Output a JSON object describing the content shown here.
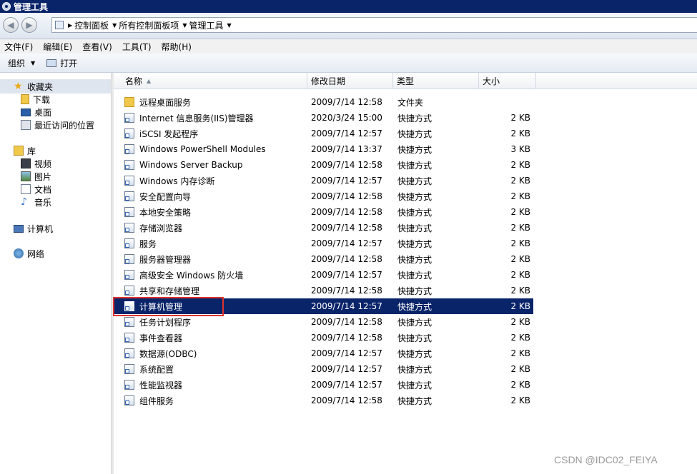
{
  "window": {
    "title": "管理工具"
  },
  "address": {
    "segments": [
      "控制面板",
      "所有控制面板项",
      "管理工具"
    ]
  },
  "menu": [
    "文件(F)",
    "编辑(E)",
    "查看(V)",
    "工具(T)",
    "帮助(H)"
  ],
  "toolbar": {
    "organize": "组织",
    "open": "打开"
  },
  "sidebar": {
    "favorites": {
      "label": "收藏夹",
      "items": [
        "下载",
        "桌面",
        "最近访问的位置"
      ]
    },
    "libraries": {
      "label": "库",
      "items": [
        "视频",
        "图片",
        "文档",
        "音乐"
      ]
    },
    "computer": "计算机",
    "network": "网络"
  },
  "columns": {
    "name": "名称",
    "date": "修改日期",
    "type": "类型",
    "size": "大小"
  },
  "rows": [
    {
      "name": "远程桌面服务",
      "date": "2009/7/14 12:58",
      "type": "文件夹",
      "size": "",
      "icon": "folder-icon"
    },
    {
      "name": "Internet 信息服务(IIS)管理器",
      "date": "2020/3/24 15:00",
      "type": "快捷方式",
      "size": "2 KB",
      "icon": "shortcut-icon"
    },
    {
      "name": "iSCSI 发起程序",
      "date": "2009/7/14 12:57",
      "type": "快捷方式",
      "size": "2 KB",
      "icon": "shortcut-icon"
    },
    {
      "name": "Windows PowerShell Modules",
      "date": "2009/7/14 13:37",
      "type": "快捷方式",
      "size": "3 KB",
      "icon": "shortcut-icon"
    },
    {
      "name": "Windows Server Backup",
      "date": "2009/7/14 12:58",
      "type": "快捷方式",
      "size": "2 KB",
      "icon": "shortcut-icon"
    },
    {
      "name": "Windows 内存诊断",
      "date": "2009/7/14 12:57",
      "type": "快捷方式",
      "size": "2 KB",
      "icon": "shortcut-icon"
    },
    {
      "name": "安全配置向导",
      "date": "2009/7/14 12:58",
      "type": "快捷方式",
      "size": "2 KB",
      "icon": "shortcut-icon"
    },
    {
      "name": "本地安全策略",
      "date": "2009/7/14 12:58",
      "type": "快捷方式",
      "size": "2 KB",
      "icon": "shortcut-icon"
    },
    {
      "name": "存储浏览器",
      "date": "2009/7/14 12:58",
      "type": "快捷方式",
      "size": "2 KB",
      "icon": "shortcut-icon"
    },
    {
      "name": "服务",
      "date": "2009/7/14 12:57",
      "type": "快捷方式",
      "size": "2 KB",
      "icon": "shortcut-icon"
    },
    {
      "name": "服务器管理器",
      "date": "2009/7/14 12:58",
      "type": "快捷方式",
      "size": "2 KB",
      "icon": "shortcut-icon"
    },
    {
      "name": "高级安全 Windows 防火墙",
      "date": "2009/7/14 12:57",
      "type": "快捷方式",
      "size": "2 KB",
      "icon": "shortcut-icon"
    },
    {
      "name": "共享和存储管理",
      "date": "2009/7/14 12:58",
      "type": "快捷方式",
      "size": "2 KB",
      "icon": "shortcut-icon"
    },
    {
      "name": "计算机管理",
      "date": "2009/7/14 12:57",
      "type": "快捷方式",
      "size": "2 KB",
      "icon": "shortcut-icon",
      "selected": true
    },
    {
      "name": "任务计划程序",
      "date": "2009/7/14 12:58",
      "type": "快捷方式",
      "size": "2 KB",
      "icon": "shortcut-icon"
    },
    {
      "name": "事件查看器",
      "date": "2009/7/14 12:58",
      "type": "快捷方式",
      "size": "2 KB",
      "icon": "shortcut-icon"
    },
    {
      "name": "数据源(ODBC)",
      "date": "2009/7/14 12:57",
      "type": "快捷方式",
      "size": "2 KB",
      "icon": "shortcut-icon"
    },
    {
      "name": "系统配置",
      "date": "2009/7/14 12:57",
      "type": "快捷方式",
      "size": "2 KB",
      "icon": "shortcut-icon"
    },
    {
      "name": "性能监视器",
      "date": "2009/7/14 12:57",
      "type": "快捷方式",
      "size": "2 KB",
      "icon": "shortcut-icon"
    },
    {
      "name": "组件服务",
      "date": "2009/7/14 12:58",
      "type": "快捷方式",
      "size": "2 KB",
      "icon": "shortcut-icon"
    }
  ],
  "watermark": "CSDN @IDC02_FEIYA",
  "colors": {
    "title_bar": "#0a246a",
    "selection": "#0a246a",
    "highlight_box": "#e0312e"
  }
}
